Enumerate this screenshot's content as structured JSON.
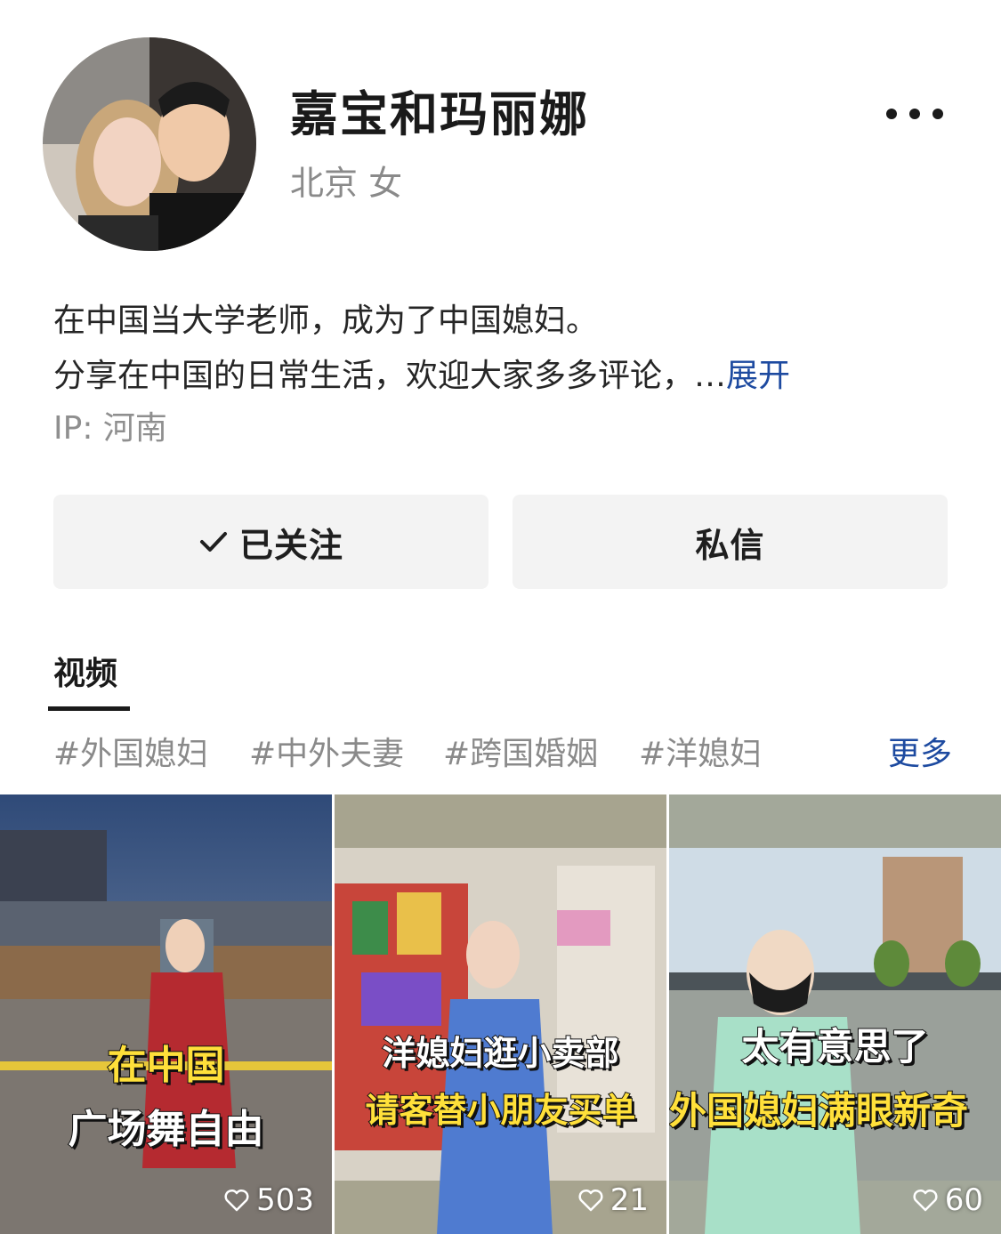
{
  "profile": {
    "name": "嘉宝和玛丽娜",
    "location_gender": "北京 女",
    "bio_line1": "在中国当大学老师，成为了中国媳妇。",
    "bio_line2": "分享在中国的日常生活，欢迎大家多多评论，…",
    "bio_expand": "展开",
    "ip": "IP: 河南"
  },
  "actions": {
    "follow_label": "已关注",
    "message_label": "私信"
  },
  "tabs": [
    {
      "label": "视频",
      "active": true
    }
  ],
  "tags": [
    "#外国媳妇",
    "#中外夫妻",
    "#跨国婚姻",
    "#洋媳妇"
  ],
  "tags_more": "更多",
  "videos": [
    {
      "caption_line1": "在中国",
      "caption_line2": "广场舞自由",
      "likes": "503"
    },
    {
      "caption_line1": "洋媳妇逛小卖部",
      "caption_line2": "请客替小朋友买单",
      "likes": "21"
    },
    {
      "caption_line1": "太有意思了",
      "caption_line2": "外国媳妇满眼新奇",
      "likes": "60"
    }
  ],
  "icons": {
    "more": "more-horizontal-icon",
    "check": "check-icon",
    "like": "heart-outline-icon"
  },
  "colors": {
    "link": "#1d4aa0",
    "caption_yellow": "#ffe03a",
    "button_bg": "#f3f3f3"
  }
}
